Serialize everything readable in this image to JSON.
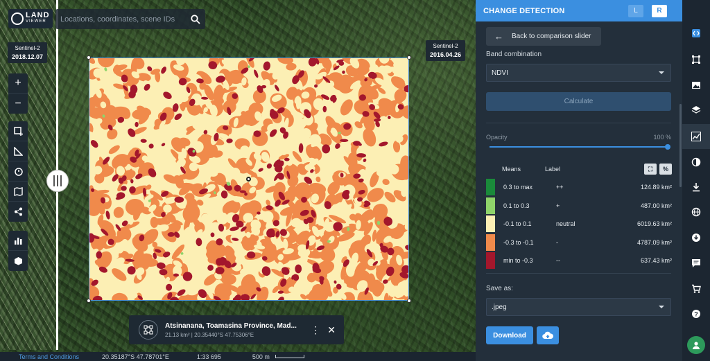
{
  "search": {
    "placeholder": "Locations, coordinates, scene IDs"
  },
  "logo": {
    "line1": "LAND",
    "line2": "VIEWER"
  },
  "left_scene": {
    "sensor": "Sentinel-2",
    "date": "2018.12.07"
  },
  "right_scene": {
    "sensor": "Sentinel-2",
    "date": "2016.04.26"
  },
  "map_tools": {
    "zoom_in": "+",
    "zoom_out": "−"
  },
  "area_card": {
    "title": "Atsinanana, Toamasina Province, Mad...",
    "subtitle": "21.13 km² | 20.35440°S 47.75306°E"
  },
  "status_bar": {
    "terms": "Terms and Conditions",
    "coordinates": "20.35187°S 47.78701°E",
    "zoom": "1:33 695",
    "scale": "500 m"
  },
  "panel": {
    "title": "CHANGE DETECTION",
    "left_toggle": "L",
    "right_toggle": "R",
    "back_label": "Back to comparison slider",
    "band_combination_label": "Band combination",
    "band_combination_value": "NDVI",
    "calculate_label": "Calculate",
    "opacity_label": "Opacity",
    "opacity_value": "100 %",
    "legend": {
      "means_header": "Means",
      "label_header": "Label",
      "percent_toggle": "%",
      "rows": [
        {
          "color": "#1a8a3a",
          "means": "0.3 to max",
          "label": "++",
          "area": "124.89 km²"
        },
        {
          "color": "#8fd46a",
          "means": "0.1 to 0.3",
          "label": "+",
          "area": "487.00 km²"
        },
        {
          "color": "#fcefb4",
          "means": "-0.1 to 0.1",
          "label": "neutral",
          "area": "6019.63 km²"
        },
        {
          "color": "#f08a4b",
          "means": "-0.3 to -0.1",
          "label": "-",
          "area": "4787.09 km²"
        },
        {
          "color": "#a3172c",
          "means": "min to -0.3",
          "label": "--",
          "area": "637.43 km²"
        }
      ]
    },
    "save_as_label": "Save as:",
    "save_as_value": ".jpeg",
    "download_label": "Download"
  },
  "raster_colors": {
    "neutral": "#fcefb4",
    "minus": "#f08a4b",
    "minusminus": "#a3172c",
    "plus": "#8fd46a"
  }
}
